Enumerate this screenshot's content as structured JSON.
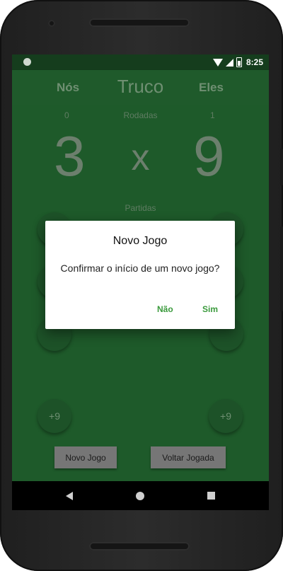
{
  "status_bar": {
    "time": "8:25"
  },
  "app_bar": {
    "left_label": "Nós",
    "title": "Truco",
    "right_label": "Eles"
  },
  "score": {
    "rounds_label": "Rodadas",
    "rounds_us": "0",
    "rounds_them": "1",
    "points_us": "3",
    "separator": "x",
    "points_them": "9",
    "matches_label": "Partidas"
  },
  "score_buttons": {
    "left_bottom": "+9",
    "right_bottom": "+9"
  },
  "actions": {
    "new_game": "Novo Jogo",
    "undo": "Voltar Jogada"
  },
  "dialog": {
    "title": "Novo Jogo",
    "message": "Confirmar o início de um novo jogo?",
    "no_label": "Não",
    "yes_label": "Sim",
    "accent_color": "#3a9a3c"
  },
  "nav_bar": {
    "back": "back-icon",
    "home": "home-icon",
    "recent": "recent-apps-icon"
  }
}
